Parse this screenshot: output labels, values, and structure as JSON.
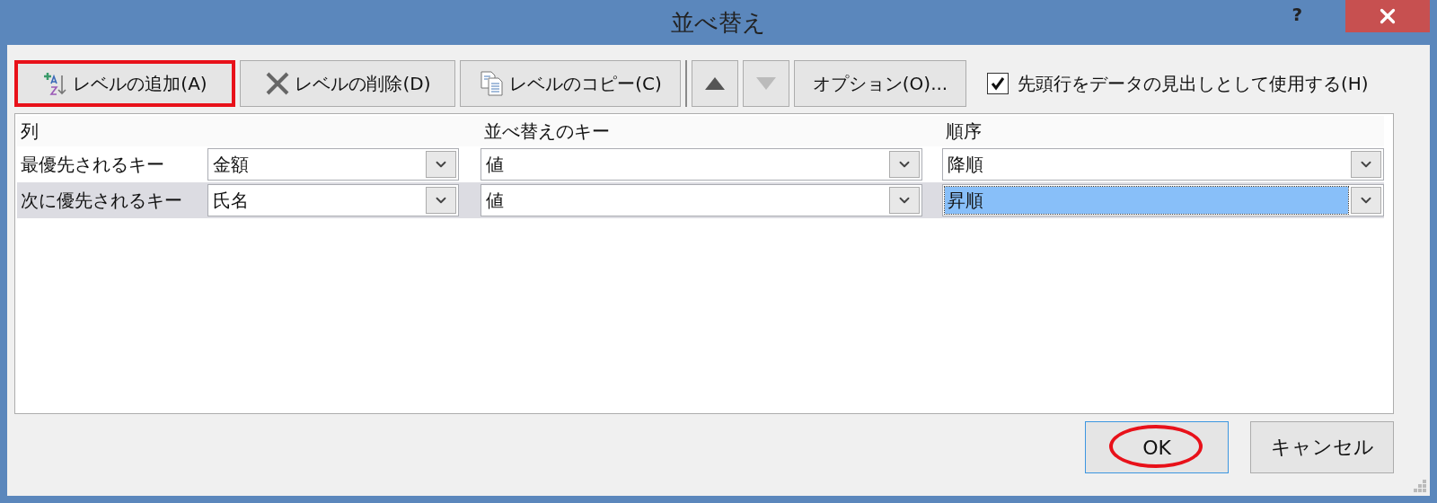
{
  "window": {
    "title": "並べ替え",
    "help": "?"
  },
  "toolbar": [
    {
      "kind": "add",
      "label": "レベルの追加(A)",
      "disabled": false,
      "annotated": true
    },
    {
      "kind": "delete",
      "label": "レベルの削除(D)",
      "disabled": false,
      "annotated": false
    },
    {
      "kind": "copy",
      "label": "レベルのコピー(C)",
      "disabled": false,
      "annotated": false
    },
    {
      "kind": "up",
      "disabled": false,
      "annotated": false
    },
    {
      "kind": "down",
      "disabled": true,
      "annotated": false
    },
    {
      "kind": "options",
      "label": "オプション(O)...",
      "disabled": false,
      "annotated": false
    }
  ],
  "header_checkbox": {
    "label": "先頭行をデータの見出しとして使用する(H)",
    "checked": true
  },
  "table": {
    "columns": [
      "列",
      "並べ替えのキー",
      "順序"
    ],
    "rows": [
      {
        "label": "最優先されるキー",
        "selected": false,
        "cells": [
          {
            "value": "金額",
            "highlighted": false
          },
          {
            "value": "値",
            "highlighted": false
          },
          {
            "value": "降順",
            "highlighted": false
          }
        ]
      },
      {
        "label": "次に優先されるキー",
        "selected": true,
        "cells": [
          {
            "value": "氏名",
            "highlighted": false
          },
          {
            "value": "値",
            "highlighted": false
          },
          {
            "value": "昇順",
            "highlighted": true
          }
        ]
      }
    ]
  },
  "buttons": [
    {
      "label": "OK",
      "default": true,
      "annotated": true
    },
    {
      "label": "キャンセル",
      "default": false,
      "annotated": false
    }
  ]
}
